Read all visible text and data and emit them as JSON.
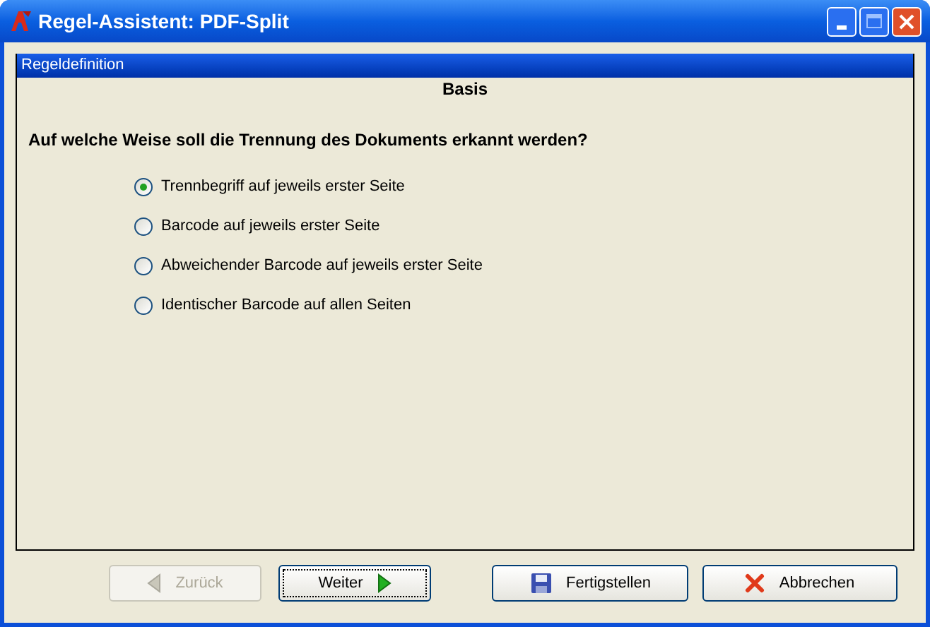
{
  "window": {
    "title": "Regel-Assistent: PDF-Split"
  },
  "panel": {
    "title": "Regeldefinition",
    "section": "Basis",
    "question": "Auf welche Weise soll die Trennung des Dokuments erkannt werden?",
    "options": [
      {
        "label": "Trennbegriff auf jeweils erster Seite",
        "selected": true
      },
      {
        "label": "Barcode auf jeweils erster Seite",
        "selected": false
      },
      {
        "label": "Abweichender Barcode auf jeweils erster Seite",
        "selected": false
      },
      {
        "label": "Identischer Barcode auf allen Seiten",
        "selected": false
      }
    ]
  },
  "buttons": [
    {
      "kind": "back",
      "label": "Zurück",
      "disabled": true,
      "focused": false
    },
    {
      "kind": "next",
      "label": "Weiter",
      "disabled": false,
      "focused": true
    },
    {
      "kind": "finish",
      "label": "Fertigstellen",
      "disabled": false,
      "focused": false
    },
    {
      "kind": "cancel",
      "label": "Abbrechen",
      "disabled": false,
      "focused": false
    }
  ]
}
